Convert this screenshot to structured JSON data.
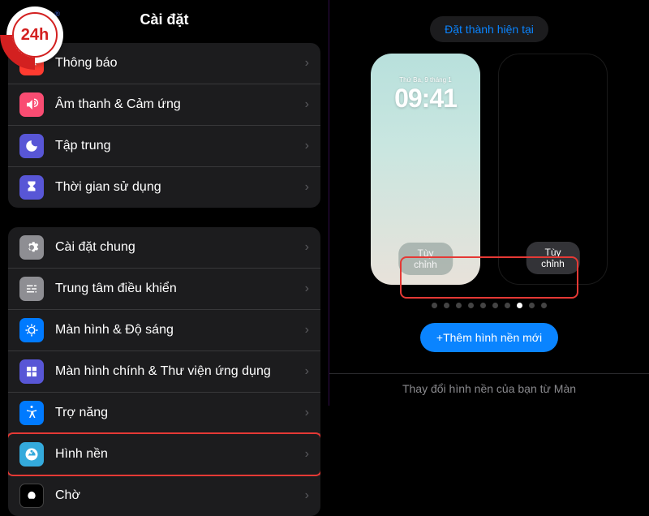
{
  "watermark": {
    "text": "24h",
    "reg": "®"
  },
  "left": {
    "title": "Cài đặt",
    "group1": [
      {
        "key": "thong-bao",
        "icon": "bell-icon",
        "color": "ic-red",
        "label": "Thông báo"
      },
      {
        "key": "am-thanh",
        "icon": "sound-icon",
        "color": "ic-pink",
        "label": "Âm thanh & Cảm ứng"
      },
      {
        "key": "tap-trung",
        "icon": "moon-icon",
        "color": "ic-indigo",
        "label": "Tập trung"
      },
      {
        "key": "thoi-gian",
        "icon": "hourglass-icon",
        "color": "ic-indigo",
        "label": "Thời gian sử dụng"
      }
    ],
    "group2": [
      {
        "key": "cai-dat-chung",
        "icon": "gear-icon",
        "color": "ic-gray",
        "label": "Cài đặt chung"
      },
      {
        "key": "trung-tam",
        "icon": "sliders-icon",
        "color": "ic-gray",
        "label": "Trung tâm điều khiển"
      },
      {
        "key": "man-hinh-do-sang",
        "icon": "brightness-icon",
        "color": "ic-blue",
        "label": "Màn hình & Độ sáng"
      },
      {
        "key": "man-hinh-chinh",
        "icon": "grid-icon",
        "color": "ic-indigo",
        "label": "Màn hình chính & Thư viện ứng dụng"
      },
      {
        "key": "tro-nang",
        "icon": "accessibility-icon",
        "color": "ic-blue",
        "label": "Trợ năng"
      },
      {
        "key": "hinh-nen",
        "icon": "wallpaper-icon",
        "color": "ic-cyan",
        "label": "Hình nền",
        "highlight": true
      },
      {
        "key": "cho",
        "icon": "standby-icon",
        "color": "ic-black",
        "label": "Chờ"
      }
    ]
  },
  "right": {
    "set_current": "Đặt thành hiện tại",
    "lockscreen": {
      "date": "Thứ Ba, 9 tháng 1",
      "time": "09:41"
    },
    "customize_label": "Tùy chỉnh",
    "dots": {
      "count": 10,
      "active": 7
    },
    "add_new": "+Thêm hình nền mới",
    "footer": "Thay đổi hình nền của bạn từ Màn"
  }
}
